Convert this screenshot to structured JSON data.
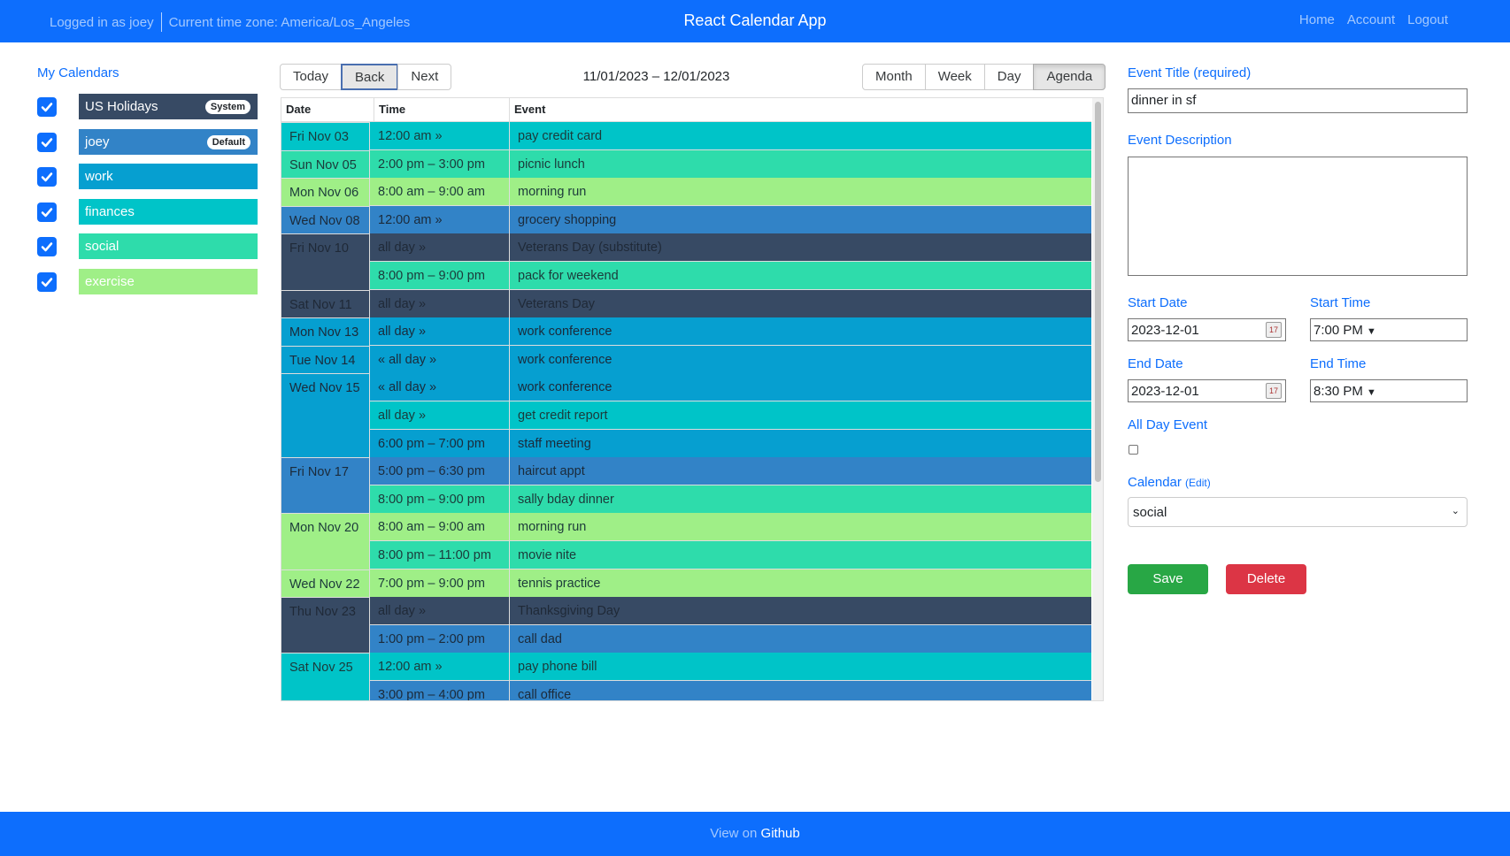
{
  "header": {
    "logged_in": "Logged in as joey",
    "timezone": "Current time zone: America/Los_Angeles",
    "title": "React Calendar App",
    "nav": [
      "Home",
      "Account",
      "Logout"
    ]
  },
  "calendars": {
    "title": "My Calendars",
    "items": [
      {
        "label": "US Holidays",
        "badge": "System",
        "color": "#374a64",
        "checked": true
      },
      {
        "label": "joey",
        "badge": "Default",
        "color": "#3283c7",
        "checked": true
      },
      {
        "label": "work",
        "badge": "",
        "color": "#069fd0",
        "checked": true
      },
      {
        "label": "finances",
        "badge": "",
        "color": "#00c4c8",
        "checked": true
      },
      {
        "label": "social",
        "badge": "",
        "color": "#2edcab",
        "checked": true
      },
      {
        "label": "exercise",
        "badge": "",
        "color": "#9fef87",
        "checked": true
      }
    ]
  },
  "toolbar": {
    "today": "Today",
    "back": "Back",
    "next": "Next",
    "range": "11/01/2023 – 12/01/2023",
    "views": [
      "Month",
      "Week",
      "Day",
      "Agenda"
    ],
    "active_view": "Agenda"
  },
  "agenda": {
    "headers": {
      "date": "Date",
      "time": "Time",
      "event": "Event"
    },
    "rows": [
      {
        "date": "Fri Nov 03",
        "time": "12:00 am »",
        "event": "pay credit card",
        "color": "#00c4c8",
        "date_color": "#00c4c8",
        "text": "#1b3a3a"
      },
      {
        "date": "Sun Nov 05",
        "time": "2:00 pm – 3:00 pm",
        "event": "picnic lunch",
        "color": "#2edcab",
        "date_color": "#2edcab",
        "text": "#1b3a3a"
      },
      {
        "date": "Mon Nov 06",
        "time": "8:00 am – 9:00 am",
        "event": "morning run",
        "color": "#9fef87",
        "date_color": "#9fef87",
        "text": "#1b3a3a"
      },
      {
        "date": "Wed Nov 08",
        "time": "12:00 am »",
        "event": "grocery shopping",
        "color": "#3283c7",
        "date_color": "#3283c7",
        "text": "#1b2a3a"
      },
      {
        "date": "Fri Nov 10",
        "time": "all day »",
        "event": "Veterans Day (substitute)",
        "color": "#374a64",
        "date_color": "#374a64",
        "text": "#1f2937"
      },
      {
        "date": "",
        "time": "8:00 pm – 9:00 pm",
        "event": "pack for weekend",
        "color": "#2edcab",
        "date_color": "#374a64",
        "text": "#1b3a3a"
      },
      {
        "date": "Sat Nov 11",
        "time": "all day »",
        "event": "Veterans Day",
        "color": "#374a64",
        "date_color": "#374a64",
        "text": "#1f2937"
      },
      {
        "date": "Mon Nov 13",
        "time": "all day »",
        "event": "work conference",
        "color": "#069fd0",
        "date_color": "#069fd0",
        "text": "#1b2a3a"
      },
      {
        "date": "Tue Nov 14",
        "time": "« all day »",
        "event": "work conference",
        "color": "#069fd0",
        "date_color": "#069fd0",
        "text": "#1b2a3a"
      },
      {
        "date": "Wed Nov 15",
        "time": "« all day »",
        "event": "work conference",
        "color": "#069fd0",
        "date_color": "#069fd0",
        "text": "#1b2a3a"
      },
      {
        "date": "",
        "time": "all day »",
        "event": "get credit report",
        "color": "#00c4c8",
        "date_color": "#069fd0",
        "text": "#1b3a3a"
      },
      {
        "date": "",
        "time": "6:00 pm – 7:00 pm",
        "event": "staff meeting",
        "color": "#069fd0",
        "date_color": "#069fd0",
        "text": "#1b2a3a"
      },
      {
        "date": "Fri Nov 17",
        "time": "5:00 pm – 6:30 pm",
        "event": "haircut appt",
        "color": "#3283c7",
        "date_color": "#3283c7",
        "text": "#1b2a3a"
      },
      {
        "date": "",
        "time": "8:00 pm – 9:00 pm",
        "event": "sally bday dinner",
        "color": "#2edcab",
        "date_color": "#3283c7",
        "text": "#1b3a3a"
      },
      {
        "date": "Mon Nov 20",
        "time": "8:00 am – 9:00 am",
        "event": "morning run",
        "color": "#9fef87",
        "date_color": "#9fef87",
        "text": "#1b3a3a"
      },
      {
        "date": "",
        "time": "8:00 pm – 11:00 pm",
        "event": "movie nite",
        "color": "#2edcab",
        "date_color": "#9fef87",
        "text": "#1b3a3a"
      },
      {
        "date": "Wed Nov 22",
        "time": "7:00 pm – 9:00 pm",
        "event": "tennis practice",
        "color": "#9fef87",
        "date_color": "#9fef87",
        "text": "#1b3a3a"
      },
      {
        "date": "Thu Nov 23",
        "time": "all day »",
        "event": "Thanksgiving Day",
        "color": "#374a64",
        "date_color": "#374a64",
        "text": "#1f2937"
      },
      {
        "date": "",
        "time": "1:00 pm – 2:00 pm",
        "event": "call dad",
        "color": "#3283c7",
        "date_color": "#374a64",
        "text": "#1b2a3a"
      },
      {
        "date": "Sat Nov 25",
        "time": "12:00 am »",
        "event": "pay phone bill",
        "color": "#00c4c8",
        "date_color": "#00c4c8",
        "text": "#1b3a3a"
      },
      {
        "date": "",
        "time": "3:00 pm – 4:00 pm",
        "event": "call office",
        "color": "#3283c7",
        "date_color": "#00c4c8",
        "text": "#1b2a3a"
      }
    ]
  },
  "form": {
    "title_label": "Event Title (required)",
    "title_value": "dinner in sf",
    "description_label": "Event Description",
    "description_value": "",
    "start_date_label": "Start Date",
    "start_date": "2023-12-01",
    "start_time_label": "Start Time",
    "start_time": "7:00  PM",
    "end_date_label": "End Date",
    "end_date": "2023-12-01",
    "end_time_label": "End Time",
    "end_time": "8:30  PM",
    "all_day_label": "All Day Event",
    "calendar_label": "Calendar",
    "calendar_edit": "(Edit)",
    "calendar_value": "social",
    "save": "Save",
    "delete": "Delete",
    "save_color": "#28a745",
    "delete_color": "#dc3545"
  },
  "footer": {
    "prefix": "View on",
    "link": "Github"
  }
}
